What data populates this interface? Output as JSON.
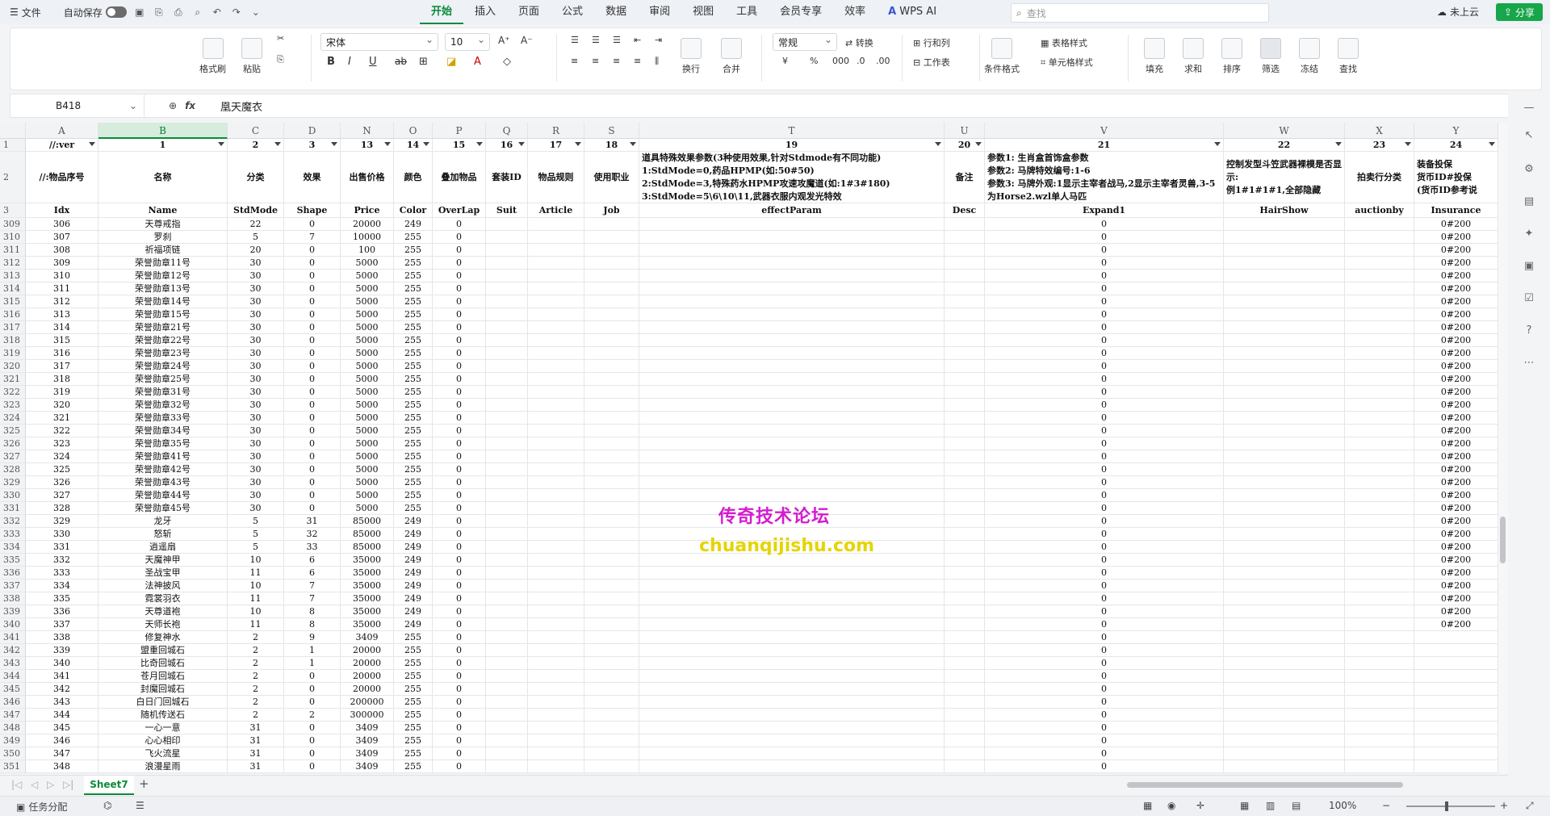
{
  "topbar": {
    "menu_label": "文件",
    "autosave_label": "自动保存",
    "tabs": [
      "开始",
      "插入",
      "页面",
      "公式",
      "数据",
      "审阅",
      "视图",
      "工具",
      "会员专享",
      "效率"
    ],
    "active_tab": "开始",
    "wps_ai": "WPS AI",
    "search_placeholder": "查找",
    "cloud_label": "未上云",
    "share_label": "分享"
  },
  "ribbon": {
    "format_painter": "格式刷",
    "paste": "粘贴",
    "font_name": "宋体",
    "font_size": "10",
    "wrap": "换行",
    "merge": "合并",
    "number_format": "常规",
    "convert": "转换",
    "row_col": "行和列",
    "worksheet": "工作表",
    "cond_format": "条件格式",
    "table_style": "表格样式",
    "cell_style": "单元格样式",
    "fill": "填充",
    "sum": "求和",
    "sort": "排序",
    "filter": "筛选",
    "freeze": "冻结",
    "find": "查找"
  },
  "formula_bar": {
    "name_box": "B418",
    "fx": "fx",
    "value": "凰天魔衣"
  },
  "columns": [
    {
      "letter": "A",
      "row1": "//:ver",
      "row2": "//:物品序号",
      "row3": "Idx"
    },
    {
      "letter": "B",
      "row1": "1",
      "row2": "名称",
      "row3": "Name"
    },
    {
      "letter": "C",
      "row1": "2",
      "row2": "分类",
      "row3": "StdMode"
    },
    {
      "letter": "D",
      "row1": "3",
      "row2": "效果",
      "row3": "Shape"
    },
    {
      "letter": "N",
      "row1": "13",
      "row2": "出售价格",
      "row3": "Price"
    },
    {
      "letter": "O",
      "row1": "14",
      "row2": "颜色",
      "row3": "Color"
    },
    {
      "letter": "P",
      "row1": "15",
      "row2": "叠加物品",
      "row3": "OverLap"
    },
    {
      "letter": "Q",
      "row1": "16",
      "row2": "套装ID",
      "row3": "Suit"
    },
    {
      "letter": "R",
      "row1": "17",
      "row2": "物品规则",
      "row3": "Article"
    },
    {
      "letter": "S",
      "row1": "18",
      "row2": "使用职业",
      "row3": "Job"
    },
    {
      "letter": "T",
      "row1": "19",
      "row2": "道具特殊效果参数(3种使用效果,针对Stdmode有不同功能)\n1:StdMode=0,药品HPMP(如:50#50)\n2:StdMode=3,特殊药水HPMP攻速攻魔道(如:1#3#180)\n3:StdMode=5\\6\\10\\11,武器衣服内观发光特效",
      "row3": "effectParam"
    },
    {
      "letter": "U",
      "row1": "20",
      "row2": "备注",
      "row3": "Desc"
    },
    {
      "letter": "V",
      "row1": "21",
      "row2": "参数1: 生肖盒首饰盒参数\n参数2: 马牌特效编号:1-6\n参数3: 马牌外观:1显示主宰者战马,2显示主宰者灵兽,3-5为Horse2.wzl单人马匹",
      "row3": "Expand1"
    },
    {
      "letter": "W",
      "row1": "22",
      "row2": "控制发型斗笠武器裸模是否显示:\n例1#1#1#1,全部隐藏",
      "row3": "HairShow"
    },
    {
      "letter": "X",
      "row1": "23",
      "row2": "拍卖行分类",
      "row3": "auctionby"
    },
    {
      "letter": "Y",
      "row1": "24",
      "row2": "装备投保\n货币ID#投保\n(货币ID参考说",
      "row3": "Insurance"
    }
  ],
  "rows": [
    {
      "r": "309",
      "a": "306",
      "b": "天尊戒指",
      "c": "22",
      "d": "0",
      "n": "20000",
      "o": "249",
      "p": "0",
      "v": "0",
      "y": "0#200"
    },
    {
      "r": "310",
      "a": "307",
      "b": "罗刹",
      "c": "5",
      "d": "7",
      "n": "10000",
      "o": "255",
      "p": "0",
      "v": "0",
      "y": "0#200"
    },
    {
      "r": "311",
      "a": "308",
      "b": "祈福项链",
      "c": "20",
      "d": "0",
      "n": "100",
      "o": "255",
      "p": "0",
      "v": "0",
      "y": "0#200"
    },
    {
      "r": "312",
      "a": "309",
      "b": "荣誉勋章11号",
      "c": "30",
      "d": "0",
      "n": "5000",
      "o": "255",
      "p": "0",
      "v": "0",
      "y": "0#200"
    },
    {
      "r": "313",
      "a": "310",
      "b": "荣誉勋章12号",
      "c": "30",
      "d": "0",
      "n": "5000",
      "o": "255",
      "p": "0",
      "v": "0",
      "y": "0#200"
    },
    {
      "r": "314",
      "a": "311",
      "b": "荣誉勋章13号",
      "c": "30",
      "d": "0",
      "n": "5000",
      "o": "255",
      "p": "0",
      "v": "0",
      "y": "0#200"
    },
    {
      "r": "315",
      "a": "312",
      "b": "荣誉勋章14号",
      "c": "30",
      "d": "0",
      "n": "5000",
      "o": "255",
      "p": "0",
      "v": "0",
      "y": "0#200"
    },
    {
      "r": "316",
      "a": "313",
      "b": "荣誉勋章15号",
      "c": "30",
      "d": "0",
      "n": "5000",
      "o": "255",
      "p": "0",
      "v": "0",
      "y": "0#200"
    },
    {
      "r": "317",
      "a": "314",
      "b": "荣誉勋章21号",
      "c": "30",
      "d": "0",
      "n": "5000",
      "o": "255",
      "p": "0",
      "v": "0",
      "y": "0#200"
    },
    {
      "r": "318",
      "a": "315",
      "b": "荣誉勋章22号",
      "c": "30",
      "d": "0",
      "n": "5000",
      "o": "255",
      "p": "0",
      "v": "0",
      "y": "0#200"
    },
    {
      "r": "319",
      "a": "316",
      "b": "荣誉勋章23号",
      "c": "30",
      "d": "0",
      "n": "5000",
      "o": "255",
      "p": "0",
      "v": "0",
      "y": "0#200"
    },
    {
      "r": "320",
      "a": "317",
      "b": "荣誉勋章24号",
      "c": "30",
      "d": "0",
      "n": "5000",
      "o": "255",
      "p": "0",
      "v": "0",
      "y": "0#200"
    },
    {
      "r": "321",
      "a": "318",
      "b": "荣誉勋章25号",
      "c": "30",
      "d": "0",
      "n": "5000",
      "o": "255",
      "p": "0",
      "v": "0",
      "y": "0#200"
    },
    {
      "r": "322",
      "a": "319",
      "b": "荣誉勋章31号",
      "c": "30",
      "d": "0",
      "n": "5000",
      "o": "255",
      "p": "0",
      "v": "0",
      "y": "0#200"
    },
    {
      "r": "323",
      "a": "320",
      "b": "荣誉勋章32号",
      "c": "30",
      "d": "0",
      "n": "5000",
      "o": "255",
      "p": "0",
      "v": "0",
      "y": "0#200"
    },
    {
      "r": "324",
      "a": "321",
      "b": "荣誉勋章33号",
      "c": "30",
      "d": "0",
      "n": "5000",
      "o": "255",
      "p": "0",
      "v": "0",
      "y": "0#200"
    },
    {
      "r": "325",
      "a": "322",
      "b": "荣誉勋章34号",
      "c": "30",
      "d": "0",
      "n": "5000",
      "o": "255",
      "p": "0",
      "v": "0",
      "y": "0#200"
    },
    {
      "r": "326",
      "a": "323",
      "b": "荣誉勋章35号",
      "c": "30",
      "d": "0",
      "n": "5000",
      "o": "255",
      "p": "0",
      "v": "0",
      "y": "0#200"
    },
    {
      "r": "327",
      "a": "324",
      "b": "荣誉勋章41号",
      "c": "30",
      "d": "0",
      "n": "5000",
      "o": "255",
      "p": "0",
      "v": "0",
      "y": "0#200"
    },
    {
      "r": "328",
      "a": "325",
      "b": "荣誉勋章42号",
      "c": "30",
      "d": "0",
      "n": "5000",
      "o": "255",
      "p": "0",
      "v": "0",
      "y": "0#200"
    },
    {
      "r": "329",
      "a": "326",
      "b": "荣誉勋章43号",
      "c": "30",
      "d": "0",
      "n": "5000",
      "o": "255",
      "p": "0",
      "v": "0",
      "y": "0#200"
    },
    {
      "r": "330",
      "a": "327",
      "b": "荣誉勋章44号",
      "c": "30",
      "d": "0",
      "n": "5000",
      "o": "255",
      "p": "0",
      "v": "0",
      "y": "0#200"
    },
    {
      "r": "331",
      "a": "328",
      "b": "荣誉勋章45号",
      "c": "30",
      "d": "0",
      "n": "5000",
      "o": "255",
      "p": "0",
      "v": "0",
      "y": "0#200"
    },
    {
      "r": "332",
      "a": "329",
      "b": "龙牙",
      "c": "5",
      "d": "31",
      "n": "85000",
      "o": "249",
      "p": "0",
      "v": "0",
      "y": "0#200"
    },
    {
      "r": "333",
      "a": "330",
      "b": "怒斩",
      "c": "5",
      "d": "32",
      "n": "85000",
      "o": "249",
      "p": "0",
      "v": "0",
      "y": "0#200"
    },
    {
      "r": "334",
      "a": "331",
      "b": "逍遥扇",
      "c": "5",
      "d": "33",
      "n": "85000",
      "o": "249",
      "p": "0",
      "v": "0",
      "y": "0#200"
    },
    {
      "r": "335",
      "a": "332",
      "b": "天魔神甲",
      "c": "10",
      "d": "6",
      "n": "35000",
      "o": "249",
      "p": "0",
      "v": "0",
      "y": "0#200"
    },
    {
      "r": "336",
      "a": "333",
      "b": "圣战宝甲",
      "c": "11",
      "d": "6",
      "n": "35000",
      "o": "249",
      "p": "0",
      "v": "0",
      "y": "0#200"
    },
    {
      "r": "337",
      "a": "334",
      "b": "法神披风",
      "c": "10",
      "d": "7",
      "n": "35000",
      "o": "249",
      "p": "0",
      "v": "0",
      "y": "0#200"
    },
    {
      "r": "338",
      "a": "335",
      "b": "霓裳羽衣",
      "c": "11",
      "d": "7",
      "n": "35000",
      "o": "249",
      "p": "0",
      "v": "0",
      "y": "0#200"
    },
    {
      "r": "339",
      "a": "336",
      "b": "天尊道袍",
      "c": "10",
      "d": "8",
      "n": "35000",
      "o": "249",
      "p": "0",
      "v": "0",
      "y": "0#200"
    },
    {
      "r": "340",
      "a": "337",
      "b": "天师长袍",
      "c": "11",
      "d": "8",
      "n": "35000",
      "o": "249",
      "p": "0",
      "v": "0",
      "y": "0#200"
    },
    {
      "r": "341",
      "a": "338",
      "b": "修复神水",
      "c": "2",
      "d": "9",
      "n": "3409",
      "o": "255",
      "p": "0",
      "v": "0",
      "y": ""
    },
    {
      "r": "342",
      "a": "339",
      "b": "盟重回城石",
      "c": "2",
      "d": "1",
      "n": "20000",
      "o": "255",
      "p": "0",
      "v": "0",
      "y": ""
    },
    {
      "r": "343",
      "a": "340",
      "b": "比奇回城石",
      "c": "2",
      "d": "1",
      "n": "20000",
      "o": "255",
      "p": "0",
      "v": "0",
      "y": ""
    },
    {
      "r": "344",
      "a": "341",
      "b": "苍月回城石",
      "c": "2",
      "d": "0",
      "n": "20000",
      "o": "255",
      "p": "0",
      "v": "0",
      "y": ""
    },
    {
      "r": "345",
      "a": "342",
      "b": "封魔回城石",
      "c": "2",
      "d": "0",
      "n": "20000",
      "o": "255",
      "p": "0",
      "v": "0",
      "y": ""
    },
    {
      "r": "346",
      "a": "343",
      "b": "白日门回城石",
      "c": "2",
      "d": "0",
      "n": "200000",
      "o": "255",
      "p": "0",
      "v": "0",
      "y": ""
    },
    {
      "r": "347",
      "a": "344",
      "b": "随机传送石",
      "c": "2",
      "d": "2",
      "n": "300000",
      "o": "255",
      "p": "0",
      "v": "0",
      "y": ""
    },
    {
      "r": "348",
      "a": "345",
      "b": "一心一意",
      "c": "31",
      "d": "0",
      "n": "3409",
      "o": "255",
      "p": "0",
      "v": "0",
      "y": ""
    },
    {
      "r": "349",
      "a": "346",
      "b": "心心相印",
      "c": "31",
      "d": "0",
      "n": "3409",
      "o": "255",
      "p": "0",
      "v": "0",
      "y": ""
    },
    {
      "r": "350",
      "a": "347",
      "b": "飞火流星",
      "c": "31",
      "d": "0",
      "n": "3409",
      "o": "255",
      "p": "0",
      "v": "0",
      "y": ""
    },
    {
      "r": "351",
      "a": "348",
      "b": "浪漫星雨",
      "c": "31",
      "d": "0",
      "n": "3409",
      "o": "255",
      "p": "0",
      "v": "0",
      "y": ""
    }
  ],
  "watermark": {
    "cn": "传奇技术论坛",
    "en": "chuanqijishu.com",
    "cn_color": "#d41ccf",
    "en_color": "#e6d400"
  },
  "sheet": {
    "tab": "Sheet7"
  },
  "statusbar": {
    "task": "任务分配",
    "zoom": "100%"
  },
  "colors": {
    "accent": "#0b8a3a",
    "share_bg": "#17a64a"
  }
}
